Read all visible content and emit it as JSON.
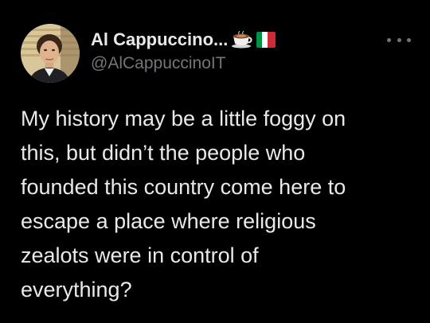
{
  "tweet": {
    "author": {
      "display_name": "Al Cappuccino...",
      "handle": "@AlCappuccinoIT",
      "name_emojis": [
        "coffee-cup-emoji",
        "italy-flag-emoji"
      ]
    },
    "text": "My history may be a little foggy on\nthis, but didn’t the people who\nfounded this country come here to\nescape a place where religious\nzealots were in control of\neverything?",
    "more_icon": "more-horizontal-icon"
  },
  "colors": {
    "background": "#000000",
    "primary_text": "#e7e9ea",
    "secondary_text": "#71767b"
  }
}
